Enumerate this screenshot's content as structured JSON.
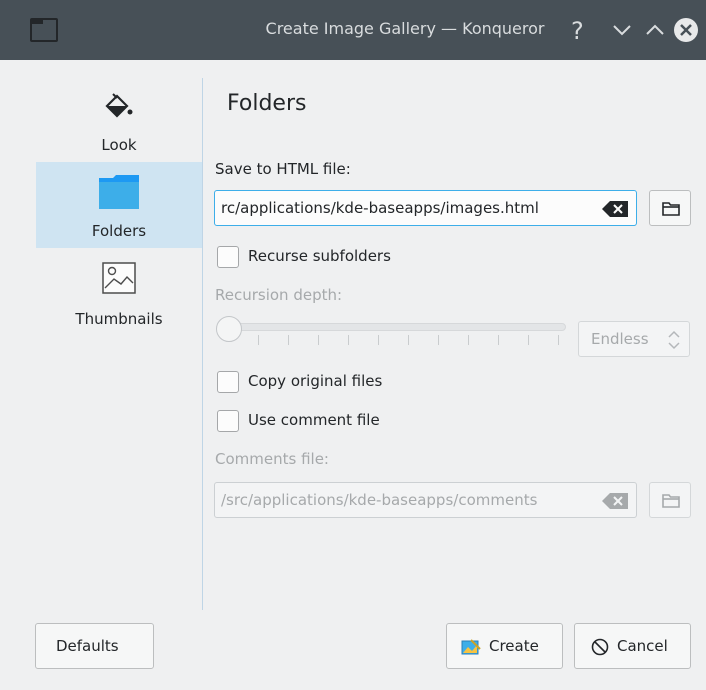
{
  "window": {
    "title": "Create Image Gallery — Konqueror"
  },
  "sidebar": {
    "items": [
      {
        "label": "Look",
        "icon": "paint-bucket-icon"
      },
      {
        "label": "Folders",
        "icon": "folder-icon",
        "selected": true
      },
      {
        "label": "Thumbnails",
        "icon": "image-icon"
      }
    ]
  },
  "page": {
    "heading": "Folders",
    "save_label": "Save to HTML file:",
    "save_value": "rc/applications/kde-baseapps/images.html",
    "recurse_label": "Recurse subfolders",
    "recurse_checked": false,
    "depth_label": "Recursion depth:",
    "depth_value": "Endless",
    "copy_label": "Copy original files",
    "copy_checked": false,
    "comment_label": "Use comment file",
    "comment_checked": false,
    "comments_file_label": "Comments file:",
    "comments_file_value": "/src/applications/kde-baseapps/comments"
  },
  "buttons": {
    "defaults": "Defaults",
    "create": "Create",
    "cancel": "Cancel"
  },
  "colors": {
    "titlebar": "#475057",
    "accent": "#3daee9",
    "selection": "#cfe4f2"
  }
}
